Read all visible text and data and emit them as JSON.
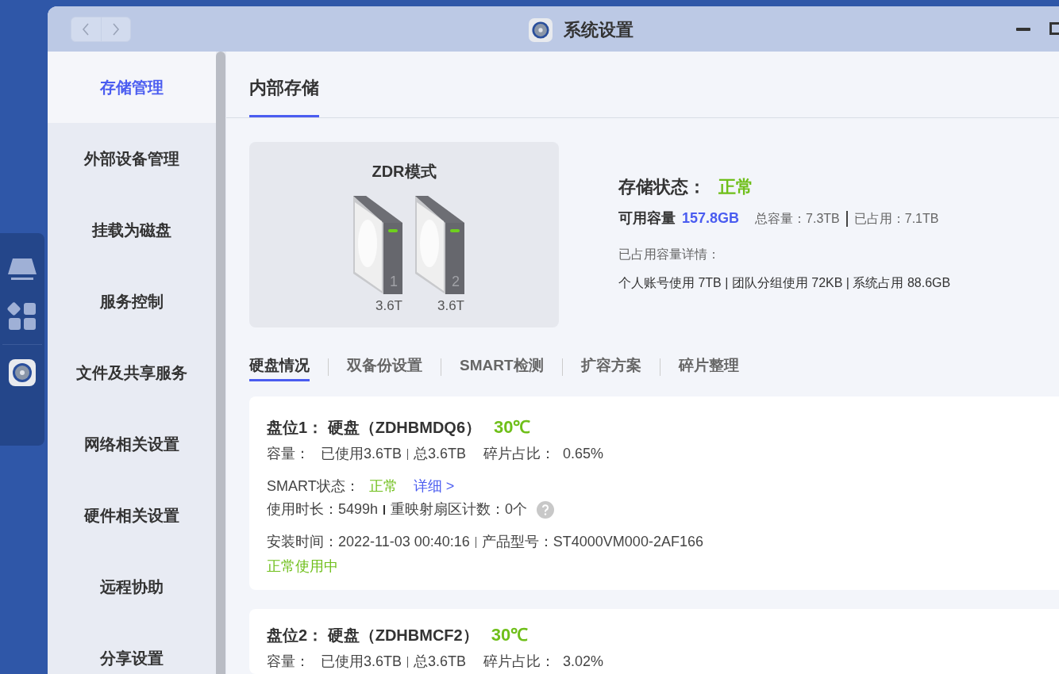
{
  "window": {
    "title": "系统设置"
  },
  "sidebar": {
    "items": [
      {
        "label": "存储管理",
        "selected": true
      },
      {
        "label": "外部设备管理",
        "selected": false
      },
      {
        "label": "挂载为磁盘",
        "selected": false
      },
      {
        "label": "服务控制",
        "selected": false
      },
      {
        "label": "文件及共享服务",
        "selected": false
      },
      {
        "label": "网络相关设置",
        "selected": false
      },
      {
        "label": "硬件相关设置",
        "selected": false
      },
      {
        "label": "远程协助",
        "selected": false
      },
      {
        "label": "分享设置",
        "selected": false
      }
    ]
  },
  "page_tabs": [
    {
      "label": "内部存储",
      "selected": true
    }
  ],
  "storage": {
    "mode": "ZDR模式",
    "drives": [
      {
        "number": "1",
        "size": "3.6T"
      },
      {
        "number": "2",
        "size": "3.6T"
      }
    ],
    "status_label": "存储状态：",
    "status_value": "正常",
    "available_label": "可用容量",
    "available_value": "157.8GB",
    "total": "总容量：7.3TB",
    "used": "已占用：7.1TB",
    "detail_label": "已占用容量详情：",
    "detail_text": "个人账号使用 7TB | 团队分组使用 72KB | 系统占用 88.6GB"
  },
  "sub_tabs": [
    {
      "label": "硬盘情况",
      "selected": true
    },
    {
      "label": "双备份设置",
      "selected": false
    },
    {
      "label": "SMART检测",
      "selected": false
    },
    {
      "label": "扩容方案",
      "selected": false
    },
    {
      "label": "碎片整理",
      "selected": false
    }
  ],
  "disks": [
    {
      "title": "盘位1： 硬盘（ZDHBMDQ6）",
      "temperature": "30℃",
      "capacity_label": "容量：",
      "used": "已使用3.6TB",
      "total": "总3.6TB",
      "frag_label": "碎片占比：",
      "frag_value": "0.65%",
      "smart_label": "SMART状态：",
      "smart_value": "正常",
      "detail_link": "详细 >",
      "hours": "使用时长：5499h",
      "remap": "重映射扇区计数：0个",
      "install_time": "安装时间：2022-11-03 00:40:16",
      "model": "产品型号：ST4000VM000-2AF166",
      "usage_status": "正常使用中"
    },
    {
      "title": "盘位2： 硬盘（ZDHBMCF2）",
      "temperature": "30℃",
      "capacity_label": "容量：",
      "used": "已使用3.6TB",
      "total": "总3.6TB",
      "frag_label": "碎片占比：",
      "frag_value": "3.02%"
    }
  ]
}
